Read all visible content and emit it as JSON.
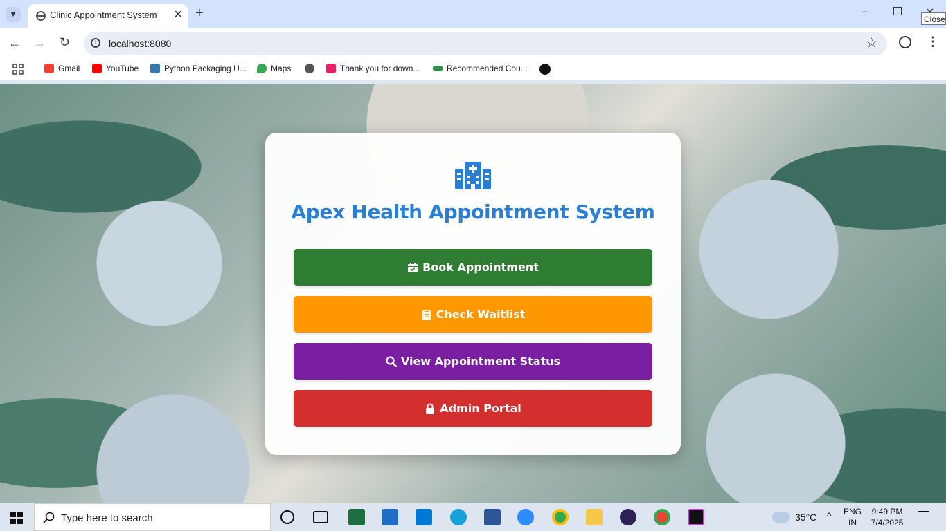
{
  "browser": {
    "tab_title": "Clinic Appointment System",
    "url": "localhost:8080",
    "tooltip": "Close",
    "bookmarks": [
      {
        "label": "Gmail",
        "color": "#ea4335"
      },
      {
        "label": "YouTube",
        "color": "#ff0000"
      },
      {
        "label": "Python Packaging U...",
        "color": "#3776ab"
      },
      {
        "label": "Maps",
        "color": "#34a853"
      },
      {
        "label": "",
        "color": "#555555"
      },
      {
        "label": "Thank you for down...",
        "color": "#e91e63"
      },
      {
        "label": "Recommended Cou...",
        "color": "#2f8d46"
      },
      {
        "label": "",
        "color": "#111111"
      }
    ]
  },
  "app": {
    "title": "Apex Health Appointment System",
    "logo_icon": "hospital-icon",
    "accent": "#2a7fd4",
    "actions": [
      {
        "label": "Book Appointment",
        "icon": "calendar-check-icon",
        "color": "#2e7d32"
      },
      {
        "label": "Check Waitlist",
        "icon": "clipboard-icon",
        "color": "#ff9800"
      },
      {
        "label": "View Appointment Status",
        "icon": "search-icon",
        "color": "#7b1fa2"
      },
      {
        "label": "Admin Portal",
        "icon": "lock-icon",
        "color": "#d32f2f"
      }
    ]
  },
  "taskbar": {
    "search_placeholder": "Type here to search",
    "weather": "35°C",
    "language_top": "ENG",
    "language_bottom": "IN",
    "time": "9:49 PM",
    "date": "7/4/2025"
  }
}
